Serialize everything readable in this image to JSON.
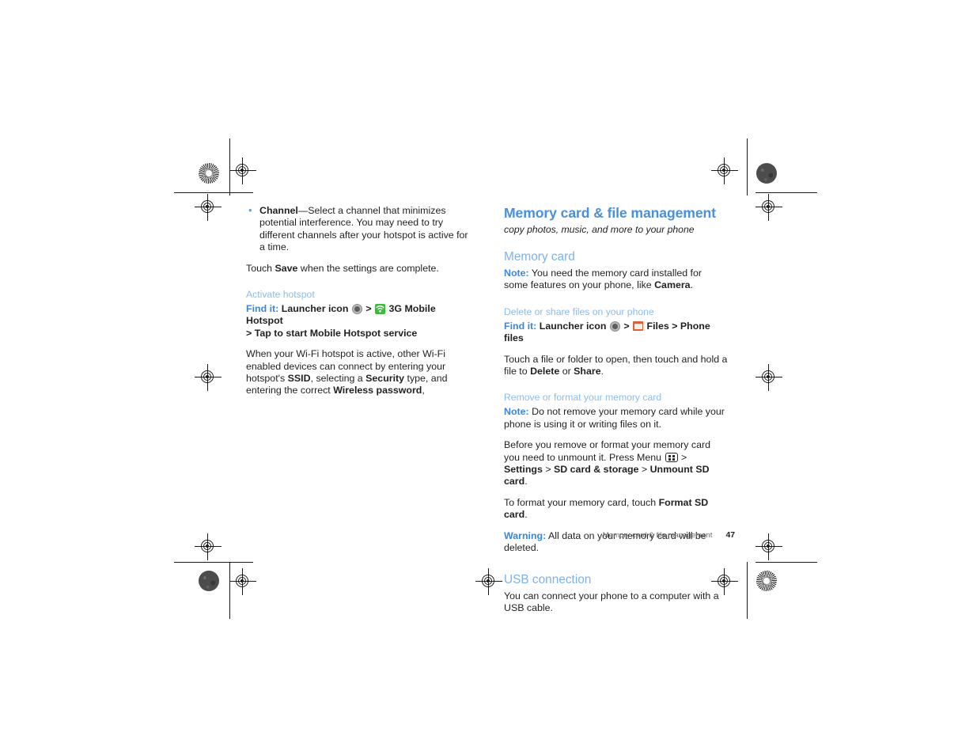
{
  "document": {
    "footer": {
      "chapter_title": "Memory card & file management",
      "page_number": "47"
    }
  },
  "left_column": {
    "bullets": [
      {
        "term": "Channel",
        "text": "—Select a channel that minimizes potential interference. You may need to try different channels after your hotspot is active for a time."
      }
    ],
    "touch_save": {
      "before": "Touch ",
      "bold": "Save",
      "after": " when the settings are complete."
    },
    "activate_hotspot": {
      "heading": "Activate hotspot",
      "find_it_label": "Find it:",
      "path_part1": "Launcher icon",
      "sep1": ">",
      "path_part2": "3G Mobile Hotspot",
      "sep2": ">",
      "path_part3": "Tap to start Mobile Hotspot service",
      "body_1": "When your Wi-Fi hotspot is active, other Wi-Fi enabled devices can connect by entering your hotspot's ",
      "bold_ssid": "SSID",
      "body_2": ", selecting a ",
      "bold_security": "Security",
      "body_3": " type, and entering the correct ",
      "bold_password": "Wireless password",
      "body_4": ","
    },
    "icons": {
      "launcher": "launcher-icon",
      "hotspot": "3g-mobile-hotspot-icon"
    }
  },
  "right_column": {
    "chapter": {
      "title": "Memory card & file management",
      "subtitle": "copy photos, music, and more to your phone"
    },
    "memory_card": {
      "heading": "Memory card",
      "note_label": "Note:",
      "note_text_1": " You need the memory card installed for some features on your phone, like ",
      "note_bold": "Camera",
      "note_text_2": "."
    },
    "delete_share": {
      "heading": "Delete or share files on your phone",
      "find_it_label": "Find it:",
      "path_part1": "Launcher icon",
      "sep1": ">",
      "path_part2": "Files",
      "sep2": ">",
      "path_part3": "Phone files",
      "body_1": "Touch a file or folder to open, then touch and hold a file to ",
      "bold_delete": "Delete",
      "body_2": " or ",
      "bold_share": "Share",
      "body_3": "."
    },
    "remove_format": {
      "heading": "Remove or format your memory card",
      "note_label": "Note:",
      "note_text": " Do not remove your memory card while your phone is using it or writing files on it.",
      "unmount_1": "Before you remove or format your memory card you need to unmount it. Press Menu ",
      "unmount_sep1": " > ",
      "unmount_bold1": "Settings",
      "unmount_sep2": " > ",
      "unmount_bold2": "SD card & storage",
      "unmount_sep3": " > ",
      "unmount_bold3": "Unmount SD card",
      "unmount_end": ".",
      "format_1": "To format your memory card, touch ",
      "format_bold": "Format SD card",
      "format_2": ".",
      "warning_label": "Warning:",
      "warning_text": " All data on your memory card will be deleted."
    },
    "usb": {
      "heading": "USB connection",
      "body": "You can connect your phone to a computer with a USB cable."
    },
    "icons": {
      "launcher": "launcher-icon",
      "files": "files-folder-icon",
      "menu_key": "menu-key-icon"
    }
  },
  "colors": {
    "heading_blue": "#4a8fdb",
    "section_blue": "#7cb2e8",
    "task_blue": "#8cbcec",
    "label_blue": "#3d86d6",
    "hotspot_green": "#3dba3d",
    "folder_orange": "#e0603a",
    "body_black": "#231f20"
  }
}
